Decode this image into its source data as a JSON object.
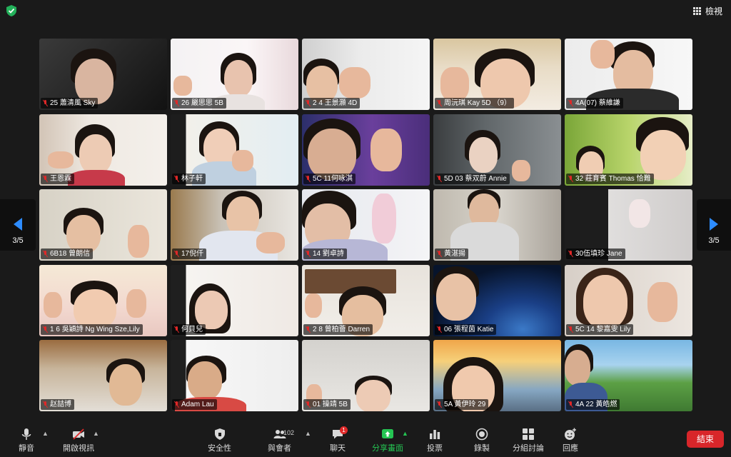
{
  "topbar": {
    "view_label": "檢視"
  },
  "pager": {
    "left_label": "3/5",
    "right_label": "3/5"
  },
  "participants": [
    "25 蕭清風 Sky",
    "26 嚴思思 5B",
    "2 4 王景灝 4D",
    "周沅琪 Kay 5D （9）",
    "4A(07) 蔡維謙",
    "王恩霖",
    "林子軒",
    "5C 11何咏淇",
    "5D 03 蔡双蔚 Annie",
    "32 莊育賓 Thomas 恰難",
    "6B18 曾朗信",
    "17倪仟",
    "14 劉卓詩",
    "黃湛揚",
    "30伍填珍 Jane",
    "1 6 吳穎詩 Ng Wing Sze,Lily",
    "何貝兒",
    "2 8 曾柏薈 Darren",
    "06 張程茵 Katie",
    "5C 14 黎嘉雯 Lily",
    "赵喆博",
    "Adam Lau",
    "01 操靖 5B",
    "5A 黃伊玲 29",
    "4A 22 黃皓燃"
  ],
  "toolbar": {
    "mute": "靜音",
    "start_video": "開啟視訊",
    "security": "安全性",
    "participants": "與會者",
    "participants_count": "102",
    "chat": "聊天",
    "chat_badge": "1",
    "share_screen": "分享畫面",
    "polls": "投票",
    "record": "錄製",
    "breakout": "分組討論",
    "reactions": "回應",
    "end": "結束"
  },
  "colors": {
    "accent": "#2d8cff",
    "share_green": "#25c553",
    "end_red": "#d8262a"
  }
}
